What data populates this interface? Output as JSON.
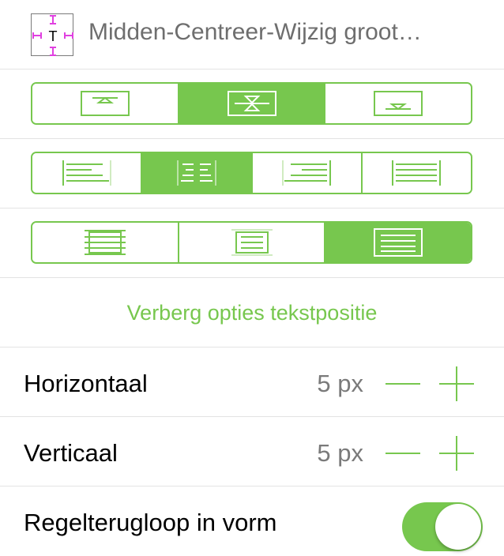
{
  "header": {
    "thumb_letter": "T",
    "title": "Midden-Centreer-Wijzig groot…"
  },
  "vertical_position": {
    "options": [
      "top-align-icon",
      "middle-align-icon",
      "bottom-align-icon"
    ],
    "selected": 1
  },
  "horizontal_alignment": {
    "options": [
      "align-left-icon",
      "align-center-icon",
      "align-right-icon",
      "align-justify-icon"
    ],
    "selected": 1
  },
  "text_fit": {
    "options": [
      "overflow-text-icon",
      "clip-text-icon",
      "fit-text-icon"
    ],
    "selected": 2
  },
  "toggle_link": "Verberg opties tekstpositie",
  "horizontal": {
    "label": "Horizontaal",
    "value": "5 px"
  },
  "vertical": {
    "label": "Verticaal",
    "value": "5 px"
  },
  "wrap": {
    "label": "Regelterugloop in vorm",
    "on": true
  },
  "colors": {
    "accent": "#77c74e",
    "title": "#6e6e6e",
    "value": "#7a7a7a"
  }
}
